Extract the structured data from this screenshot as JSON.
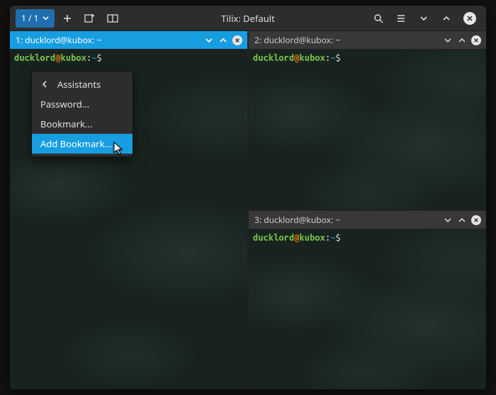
{
  "window": {
    "title": "Tilix: Default"
  },
  "titlebar": {
    "tab_counter": "1 / 1"
  },
  "panes": {
    "p1": {
      "strip": "1: ducklord@kubox: ~",
      "user": "ducklord",
      "host": "kubox",
      "path": "~",
      "dollar": "$"
    },
    "p2": {
      "strip": "2: ducklord@kubox: ~",
      "user": "ducklord",
      "host": "kubox",
      "path": "~",
      "dollar": "$"
    },
    "p3": {
      "strip": "3: ducklord@kubox: ~",
      "user": "ducklord",
      "host": "kubox",
      "path": "~",
      "dollar": "$"
    },
    "at": "@",
    "sep": ":"
  },
  "menu": {
    "header": "Assistants",
    "items": {
      "password": "Password...",
      "bookmark": "Bookmark...",
      "add_bookmark": "Add Bookmark..."
    }
  }
}
